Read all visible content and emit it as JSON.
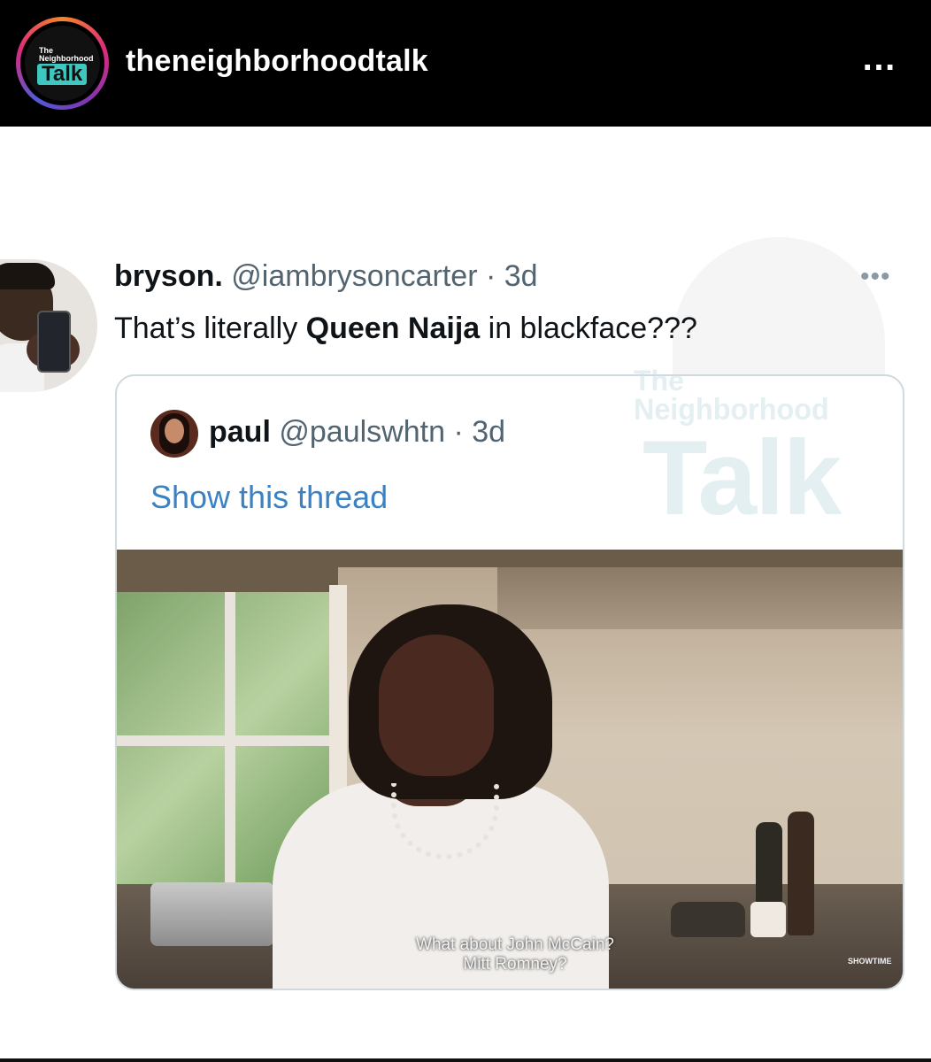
{
  "instagram": {
    "username": "theneighborhoodtalk",
    "more_icon": "…",
    "avatar_logo": {
      "line1": "The",
      "line2": "Neighborhood",
      "line3": "Talk"
    }
  },
  "tweet": {
    "name": "bryson.",
    "handle": "@iambrysoncarter",
    "separator": "·",
    "time": "3d",
    "more_icon": "•••",
    "text_before": "That’s literally ",
    "text_bold": "Queen Naija",
    "text_after": " in blackface???"
  },
  "quoted_tweet": {
    "name": "paul",
    "handle": "@paulswhtn",
    "separator": "·",
    "time": "3d",
    "show_thread": "Show this thread",
    "video": {
      "subtitle_line1": "What about John McCain?",
      "subtitle_line2": "Mitt Romney?",
      "network_logo": "SHOWTIME"
    }
  },
  "watermark": {
    "line1": "The",
    "line2": "Neighborhood",
    "line3": "Talk"
  },
  "colors": {
    "header_bg": "#000000",
    "link_blue": "#3b82c4",
    "secondary_text": "#536471",
    "logo_teal": "#3ec7c0"
  }
}
